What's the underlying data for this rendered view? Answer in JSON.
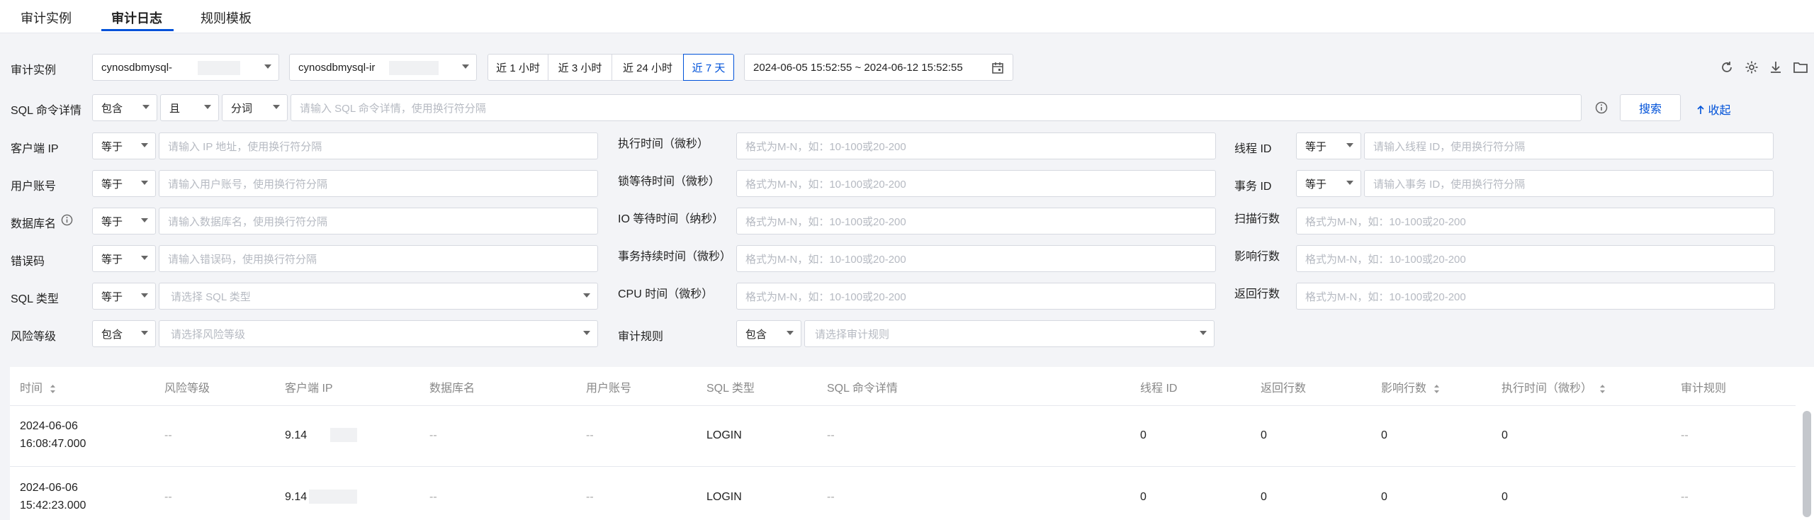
{
  "tabs": [
    {
      "label": "审计实例"
    },
    {
      "label": "审计日志"
    },
    {
      "label": "规则模板"
    }
  ],
  "filters": {
    "instance_label": "审计实例",
    "instance_select_1": "cynosdbmysql-",
    "instance_select_2": "cynosdbmysql-ir",
    "time_ranges": [
      "近 1 小时",
      "近 3 小时",
      "近 24 小时",
      "近 7 天"
    ],
    "active_range": "近 7 天",
    "date_range": "2024-06-05 15:52:55 ~ 2024-06-12 15:52:55",
    "sql_detail_label": "SQL 命令详情",
    "sql_op1": "包含",
    "sql_op2": "且",
    "sql_op3": "分词",
    "sql_placeholder": "请输入 SQL 命令详情，使用换行符分隔",
    "search_button": "搜索",
    "collapse_link": "收起",
    "col1": [
      {
        "label": "客户端 IP",
        "op": "等于",
        "placeholder": "请输入 IP 地址，使用换行符分隔"
      },
      {
        "label": "用户账号",
        "op": "等于",
        "placeholder": "请输入用户账号，使用换行符分隔"
      },
      {
        "label": "数据库名",
        "op": "等于",
        "placeholder": "请输入数据库名，使用换行符分隔"
      },
      {
        "label": "错误码",
        "op": "等于",
        "placeholder": "请输入错误码，使用换行符分隔"
      },
      {
        "label": "SQL 类型",
        "op": "等于",
        "placeholder": "请选择 SQL 类型"
      },
      {
        "label": "风险等级",
        "op": "包含",
        "placeholder": "请选择风险等级"
      }
    ],
    "col2": [
      {
        "label": "执行时间（微秒）",
        "placeholder": "格式为M-N，如：10-100或20-200"
      },
      {
        "label": "锁等待时间（微秒）",
        "placeholder": "格式为M-N，如：10-100或20-200"
      },
      {
        "label": "IO 等待时间（纳秒）",
        "placeholder": "格式为M-N，如：10-100或20-200"
      },
      {
        "label": "事务持续时间（微秒）",
        "placeholder": "格式为M-N，如：10-100或20-200"
      },
      {
        "label": "CPU 时间（微秒）",
        "placeholder": "格式为M-N，如：10-100或20-200"
      },
      {
        "label": "审计规则",
        "op": "包含",
        "placeholder": "请选择审计规则"
      }
    ],
    "col3": [
      {
        "label": "线程 ID",
        "op": "等于",
        "placeholder": "请输入线程 ID，使用换行符分隔"
      },
      {
        "label": "事务 ID",
        "op": "等于",
        "placeholder": "请输入事务 ID，使用换行符分隔"
      },
      {
        "label": "扫描行数",
        "placeholder": "格式为M-N，如：10-100或20-200"
      },
      {
        "label": "影响行数",
        "placeholder": "格式为M-N，如：10-100或20-200"
      },
      {
        "label": "返回行数",
        "placeholder": "格式为M-N，如：10-100或20-200"
      }
    ]
  },
  "table": {
    "headers": [
      "时间",
      "风险等级",
      "客户端 IP",
      "数据库名",
      "用户账号",
      "SQL 类型",
      "SQL 命令详情",
      "线程 ID",
      "返回行数",
      "影响行数",
      "执行时间（微秒）",
      "审计规则"
    ],
    "rows": [
      {
        "date": "2024-06-06",
        "time": "16:08:47.000",
        "risk": "--",
        "ip": "9.14",
        "db": "--",
        "user": "--",
        "sql_type": "LOGIN",
        "sql": "--",
        "thread": "0",
        "returned": "0",
        "affected": "0",
        "exec": "0",
        "rule": "--"
      },
      {
        "date": "2024-06-06",
        "time": "15:42:23.000",
        "risk": "--",
        "ip": "9.14",
        "db": "--",
        "user": "--",
        "sql_type": "LOGIN",
        "sql": "--",
        "thread": "0",
        "returned": "0",
        "affected": "0",
        "exec": "0",
        "rule": "--"
      }
    ]
  },
  "icons": [
    "refresh-icon",
    "settings-icon",
    "download-icon",
    "folder-icon",
    "calendar-icon",
    "info-icon",
    "arrow-up-icon",
    "sort-icon"
  ],
  "colors": {
    "accent": "#0052d9",
    "background": "#f3f4f7"
  }
}
